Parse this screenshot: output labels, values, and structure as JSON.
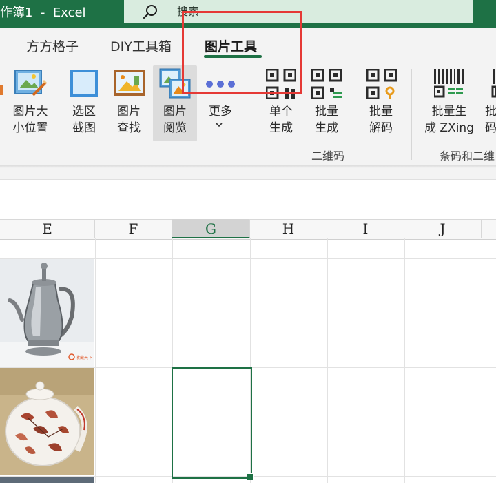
{
  "title_bar": {
    "title": "作簿1  -  Excel",
    "search_placeholder": "搜索"
  },
  "tabs": [
    {
      "label": "方方格子",
      "active": false
    },
    {
      "label": "DIY工具箱",
      "active": false
    },
    {
      "label": "图片工具",
      "active": true
    }
  ],
  "ribbon": {
    "buttons": [
      {
        "label": "图片大\n小位置",
        "icon": "picture-resize-icon"
      },
      {
        "label": "选区\n截图",
        "icon": "selection-screenshot-icon"
      },
      {
        "label": "图片\n查找",
        "icon": "picture-find-icon"
      },
      {
        "label": "图片\n阅览",
        "icon": "picture-browse-icon"
      },
      {
        "label": "更多",
        "icon": "more-dots-icon"
      },
      {
        "label": "单个\n生成",
        "icon": "qr-code-icon"
      },
      {
        "label": "批量\n生成",
        "icon": "qr-code-batch-icon"
      },
      {
        "label": "批量\n解码",
        "icon": "qr-code-decode-icon"
      },
      {
        "label": "批量生\n成 ZXing",
        "icon": "barcode-icon"
      },
      {
        "label": "批\n码",
        "icon": "barcode-partial-icon"
      }
    ],
    "groups": [
      {
        "label": "二维码"
      },
      {
        "label": "条码和二维"
      }
    ]
  },
  "sheet": {
    "columns": [
      "E",
      "F",
      "G",
      "H",
      "I",
      "J"
    ],
    "selected_column": "G",
    "images": [
      {
        "name": "silver-teapot-photo",
        "watermark": "收藏天下"
      },
      {
        "name": "floral-teapot-photo"
      }
    ]
  },
  "colors": {
    "excel_green": "#1e7145",
    "search_bg": "#d9ecdf",
    "annotation_red": "#e53935",
    "ribbon_bg": "#f3f3f3"
  }
}
